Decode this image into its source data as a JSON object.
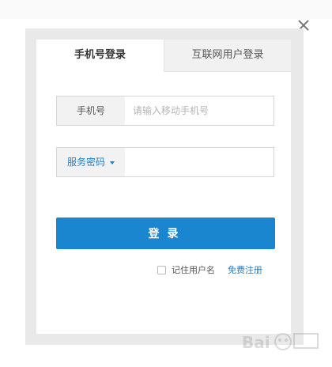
{
  "dialog": {
    "close_label": "×"
  },
  "tabs": [
    {
      "label": "手机号登录",
      "active": true
    },
    {
      "label": "互联网用户登录",
      "active": false
    }
  ],
  "phone_field": {
    "label": "手机号",
    "value": "",
    "placeholder": "请输入移动手机号"
  },
  "password_field": {
    "selector_label": "服务密码",
    "value": ""
  },
  "login_button": {
    "label": "登录"
  },
  "remember": {
    "label": "记住用户名",
    "checked": false
  },
  "register_link": {
    "label": "免费注册"
  },
  "colors": {
    "accent": "#1a86d0",
    "link": "#1e7fc8",
    "frame": "#e9e9e9"
  }
}
